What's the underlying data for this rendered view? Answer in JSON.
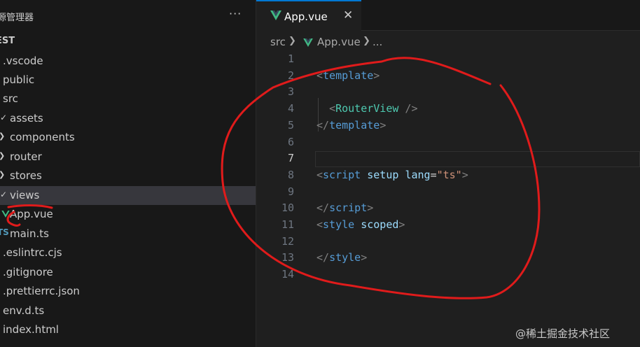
{
  "sidebar": {
    "title": "源管理器",
    "more_icon": "ellipsis-icon",
    "root_label": "EST",
    "items": [
      {
        "label": ".vscode",
        "chevron": "",
        "icon": ""
      },
      {
        "label": "public",
        "chevron": "",
        "icon": ""
      },
      {
        "label": "src",
        "chevron": "",
        "icon": ""
      },
      {
        "label": "assets",
        "chevron": "chevron-down",
        "icon": ""
      },
      {
        "label": "components",
        "chevron": "chevron-right",
        "icon": ""
      },
      {
        "label": "router",
        "chevron": "chevron-right",
        "icon": ""
      },
      {
        "label": "stores",
        "chevron": "chevron-right",
        "icon": ""
      },
      {
        "label": "views",
        "chevron": "chevron-down",
        "icon": ""
      },
      {
        "label": "App.vue",
        "chevron": "",
        "icon": "vue-icon"
      },
      {
        "label": "main.ts",
        "chevron": "",
        "icon": "ts-icon"
      },
      {
        "label": ".eslintrc.cjs",
        "chevron": "",
        "icon": ""
      },
      {
        "label": ".gitignore",
        "chevron": "",
        "icon": ""
      },
      {
        "label": ".prettierrc.json",
        "chevron": "",
        "icon": ""
      },
      {
        "label": "env.d.ts",
        "chevron": "",
        "icon": ""
      },
      {
        "label": "index.html",
        "chevron": "",
        "icon": ""
      }
    ]
  },
  "tab": {
    "label": "App.vue",
    "icon": "vue-icon",
    "close_glyph": "✕"
  },
  "breadcrumb": {
    "parts": [
      "src",
      "App.vue",
      "..."
    ]
  },
  "editor": {
    "active_line": 7,
    "lines": [
      {
        "n": "1",
        "tokens": []
      },
      {
        "n": "2",
        "tokens": [
          {
            "t": "<",
            "c": "tag-bracket"
          },
          {
            "t": "template",
            "c": "tag-name"
          },
          {
            "t": ">",
            "c": "tag-bracket"
          }
        ]
      },
      {
        "n": "3",
        "tokens": []
      },
      {
        "n": "4",
        "tokens": [
          {
            "t": "  ",
            "c": "plain"
          },
          {
            "t": "<",
            "c": "tag-bracket"
          },
          {
            "t": "RouterView",
            "c": "comp-name"
          },
          {
            "t": " />",
            "c": "tag-bracket"
          }
        ]
      },
      {
        "n": "5",
        "tokens": [
          {
            "t": "</",
            "c": "tag-bracket"
          },
          {
            "t": "template",
            "c": "tag-name"
          },
          {
            "t": ">",
            "c": "tag-bracket"
          }
        ]
      },
      {
        "n": "6",
        "tokens": []
      },
      {
        "n": "7",
        "tokens": []
      },
      {
        "n": "8",
        "tokens": [
          {
            "t": "<",
            "c": "tag-bracket"
          },
          {
            "t": "script",
            "c": "tag-name"
          },
          {
            "t": " ",
            "c": "plain"
          },
          {
            "t": "setup",
            "c": "attr-name"
          },
          {
            "t": " ",
            "c": "plain"
          },
          {
            "t": "lang",
            "c": "attr-name"
          },
          {
            "t": "=",
            "c": "plain"
          },
          {
            "t": "\"ts\"",
            "c": "attr-val"
          },
          {
            "t": ">",
            "c": "tag-bracket"
          }
        ]
      },
      {
        "n": "9",
        "tokens": []
      },
      {
        "n": "10",
        "tokens": [
          {
            "t": "</",
            "c": "tag-bracket"
          },
          {
            "t": "script",
            "c": "tag-name"
          },
          {
            "t": ">",
            "c": "tag-bracket"
          }
        ]
      },
      {
        "n": "11",
        "tokens": [
          {
            "t": "<",
            "c": "tag-bracket"
          },
          {
            "t": "style",
            "c": "tag-name"
          },
          {
            "t": " ",
            "c": "plain"
          },
          {
            "t": "scoped",
            "c": "attr-name"
          },
          {
            "t": ">",
            "c": "tag-bracket"
          }
        ]
      },
      {
        "n": "12",
        "tokens": []
      },
      {
        "n": "13",
        "tokens": [
          {
            "t": "</",
            "c": "tag-bracket"
          },
          {
            "t": "style",
            "c": "tag-name"
          },
          {
            "t": ">",
            "c": "tag-bracket"
          }
        ]
      },
      {
        "n": "14",
        "tokens": []
      }
    ]
  },
  "watermark": "@稀土掘金技术社区",
  "colors": {
    "annotation": "#e01b1b",
    "vue_green": "#41b883",
    "ts_blue": "#519aba",
    "tab_accent": "#0078d4"
  }
}
